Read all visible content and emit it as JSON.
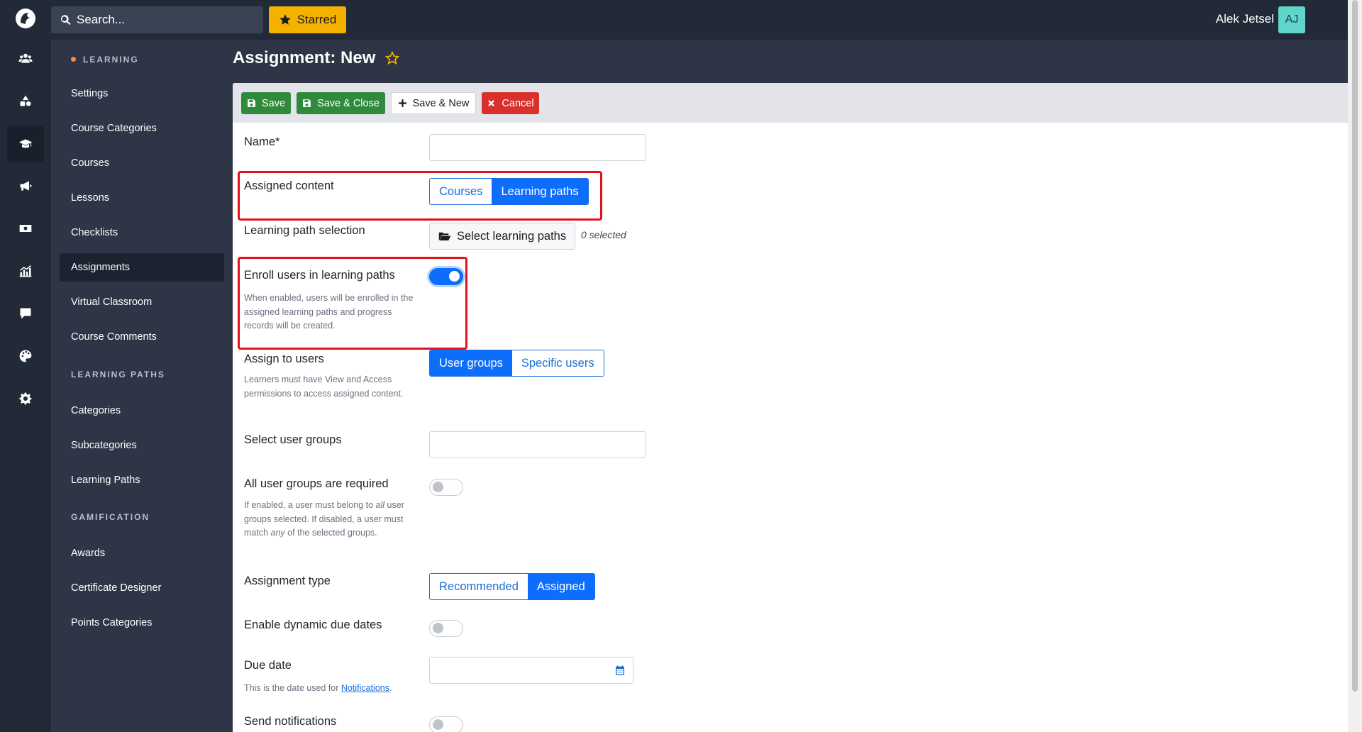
{
  "topbar": {
    "search_placeholder": "Search...",
    "starred_label": "Starred",
    "user_name": "Alek Jetsel",
    "user_initials": "AJ"
  },
  "rail": {
    "items": [
      "users-icon",
      "shapes-icon",
      "graduation-cap-icon",
      "megaphone-icon",
      "money-icon",
      "chart-icon",
      "comment-icon",
      "palette-icon",
      "gear-icon"
    ],
    "active": "graduation-cap-icon"
  },
  "sidebar": {
    "sections": [
      {
        "title": "LEARNING",
        "items": [
          "Settings",
          "Course Categories",
          "Courses",
          "Lessons",
          "Checklists",
          "Assignments",
          "Virtual Classroom",
          "Course Comments"
        ]
      },
      {
        "title": "LEARNING PATHS",
        "items": [
          "Categories",
          "Subcategories",
          "Learning Paths"
        ]
      },
      {
        "title": "GAMIFICATION",
        "items": [
          "Awards",
          "Certificate Designer",
          "Points Categories"
        ]
      }
    ],
    "active_item": "Assignments"
  },
  "page": {
    "title": "Assignment: New"
  },
  "toolbar": {
    "save_label": "Save",
    "save_close_label": "Save & Close",
    "save_new_label": "Save & New",
    "cancel_label": "Cancel"
  },
  "form": {
    "name_label": "Name*",
    "name_value": "",
    "assigned_content_label": "Assigned content",
    "assigned_content_options": [
      "Courses",
      "Learning paths"
    ],
    "assigned_content_selected": "Learning paths",
    "lp_selection_label": "Learning path selection",
    "lp_select_button": "Select learning paths",
    "lp_selected_count": "0 selected",
    "enroll_label": "Enroll users in learning paths",
    "enroll_help": "When enabled, users will be enrolled in the assigned learning paths and progress records will be created.",
    "enroll_on": true,
    "assign_users_label": "Assign to users",
    "assign_users_help": "Learners must have View and Access permissions to access assigned content.",
    "assign_users_options": [
      "User groups",
      "Specific users"
    ],
    "assign_users_selected": "User groups",
    "select_groups_label": "Select user groups",
    "select_groups_value": "",
    "all_groups_label": "All user groups are required",
    "all_groups_help_1": "If enabled, a user must belong to ",
    "all_groups_help_em1": "all",
    "all_groups_help_2": " user groups selected. If disabled, a user must match ",
    "all_groups_help_em2": "any",
    "all_groups_help_3": " of the selected groups.",
    "all_groups_on": false,
    "assignment_type_label": "Assignment type",
    "assignment_type_options": [
      "Recommended",
      "Assigned"
    ],
    "assignment_type_selected": "Assigned",
    "dynamic_due_label": "Enable dynamic due dates",
    "dynamic_due_on": false,
    "due_date_label": "Due date",
    "due_date_value": "",
    "due_date_help_prefix": "This is the date used for ",
    "due_date_help_link": "Notifications",
    "due_date_help_suffix": ".",
    "send_notifications_label": "Send notifications",
    "send_notifications_on": false
  },
  "colors": {
    "highlight": "#e0121a",
    "primary": "#0d6efd",
    "success": "#2f8a3c",
    "danger": "#d9302c",
    "starred": "#f5b100"
  }
}
